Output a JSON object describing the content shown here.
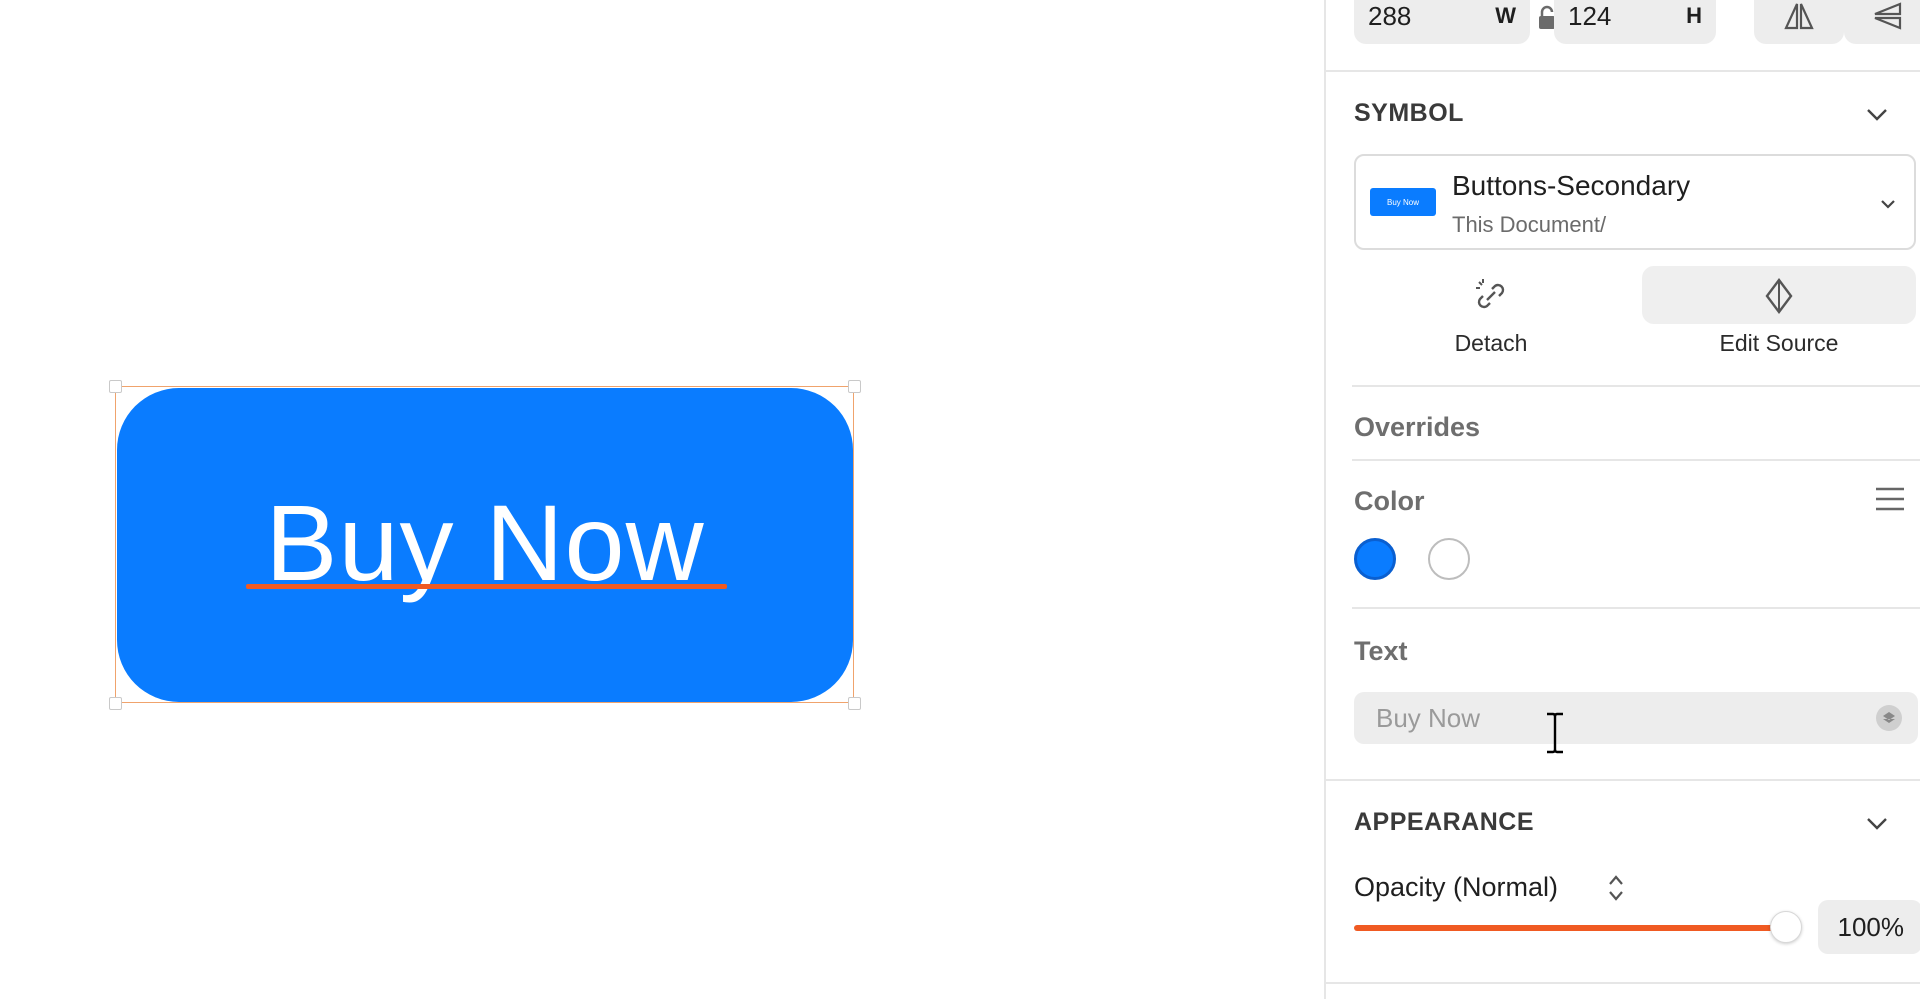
{
  "canvas": {
    "button_label": "Buy Now",
    "button_color": "#0a7cff",
    "selection_color": "#f0a36c"
  },
  "inspector": {
    "width_value": "288",
    "width_suffix": "W",
    "height_value": "124",
    "height_suffix": "H",
    "symbol": {
      "title": "SYMBOL",
      "name": "Buttons-Secondary",
      "path": "This Document/",
      "thumb_label": "Buy Now"
    },
    "actions": {
      "detach": "Detach",
      "edit_source": "Edit Source"
    },
    "overrides": {
      "title": "Overrides",
      "color_label": "Color",
      "colors": [
        "#0a7cff",
        "#ffffff"
      ],
      "text_label": "Text",
      "text_value": "Buy Now"
    },
    "appearance": {
      "title": "APPEARANCE",
      "opacity_label": "Opacity (Normal)",
      "opacity_value": "100%",
      "opacity_fraction": 1.0,
      "slider_color": "#f05a22"
    }
  }
}
